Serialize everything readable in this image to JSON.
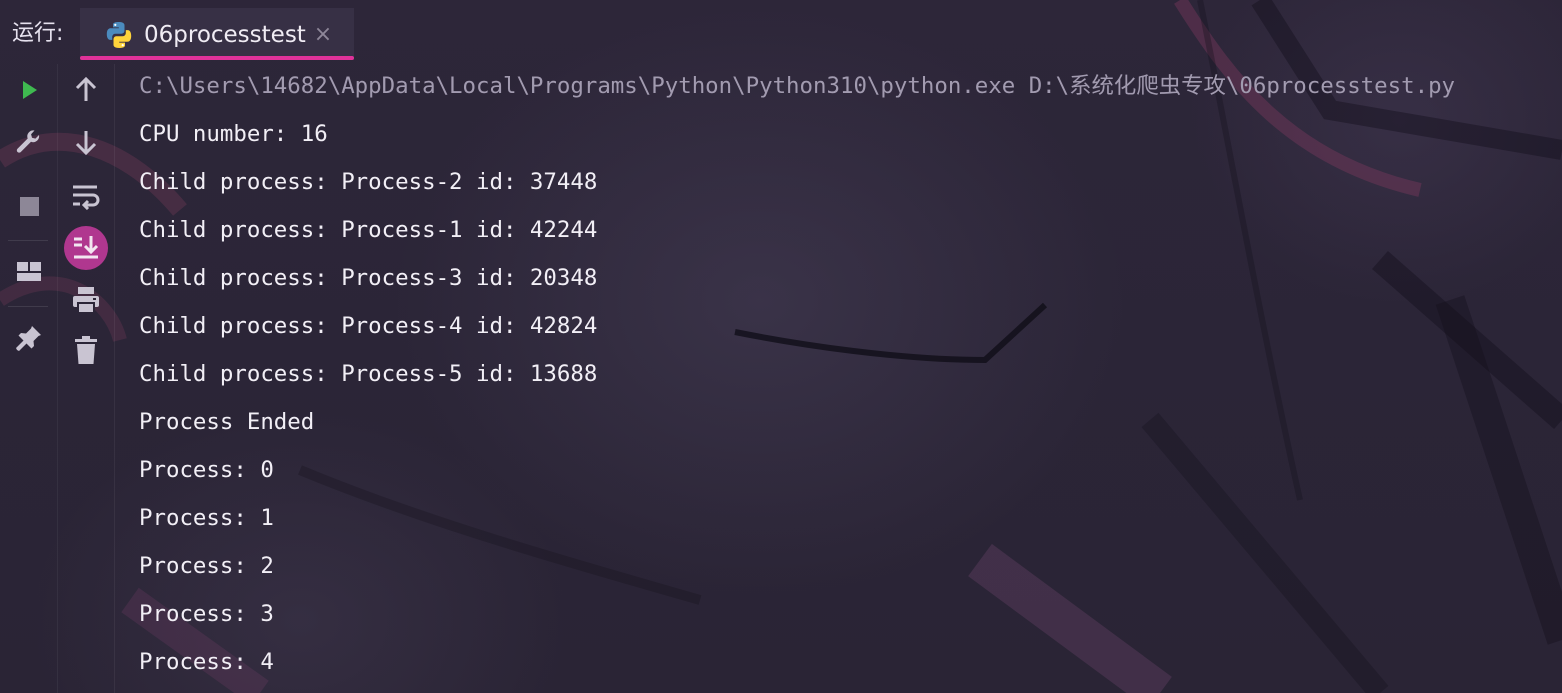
{
  "header": {
    "run_label": "运行:",
    "tab": {
      "title": "06processtest",
      "close_glyph": "×",
      "icon": "python-icon"
    },
    "accent_color": "#e0329a"
  },
  "toolbar_left": [
    {
      "icon": "run-icon",
      "color": "#3fb950"
    },
    {
      "icon": "wrench-icon"
    },
    {
      "icon": "stop-icon"
    },
    {
      "icon": "layout-icon"
    },
    {
      "icon": "pin-icon"
    }
  ],
  "toolbar_right": [
    {
      "icon": "arrow-up-icon"
    },
    {
      "icon": "arrow-down-icon"
    },
    {
      "icon": "soft-wrap-icon"
    },
    {
      "icon": "scroll-to-end-icon",
      "active": true
    },
    {
      "icon": "print-icon"
    },
    {
      "icon": "trash-icon"
    }
  ],
  "console": {
    "command": "C:\\Users\\14682\\AppData\\Local\\Programs\\Python\\Python310\\python.exe D:\\系统化爬虫专攻\\06processtest.py",
    "lines": [
      "CPU number: 16",
      "Child process: Process-2 id: 37448",
      "Child process: Process-1 id: 42244",
      "Child process: Process-3 id: 20348",
      "Child process: Process-4 id: 42824",
      "Child process: Process-5 id: 13688",
      "Process Ended",
      "Process: 0",
      "Process: 1",
      "Process: 2",
      "Process: 3",
      "Process: 4"
    ]
  }
}
